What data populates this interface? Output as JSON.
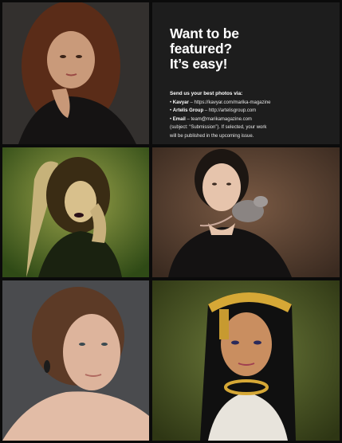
{
  "promo": {
    "headline_line1": "Want to be",
    "headline_line2": "featured?",
    "headline_line3": "It’s easy!",
    "intro": "Send us your best photos via:",
    "items": [
      {
        "bullet": "•",
        "name": "Kavyar",
        "text": " – https://kavyar.com/marika-magazine"
      },
      {
        "bullet": "•",
        "name": "Artelis Group",
        "text": " – http://artelisgroup.com"
      },
      {
        "bullet": "•",
        "name": "Email",
        "text": " – team@marikamagazine.com"
      }
    ],
    "note_line1": "(subject: “Submission”). If selected, your work",
    "note_line2": "will be published in the upcoming issue."
  },
  "photos": [
    {
      "id": "photo-1",
      "subject": "woman with curly auburn hair, hand on chin, black top"
    },
    {
      "id": "photo-2",
      "subject": "woman with dark lipstick, arm raised, green toned"
    },
    {
      "id": "photo-3",
      "subject": "woman with dark hair holding a rat on shoulder"
    },
    {
      "id": "photo-4",
      "subject": "woman with short hair and earrings, bare shoulders"
    },
    {
      "id": "photo-5",
      "subject": "woman in gold Egyptian headdress"
    }
  ],
  "colors": {
    "background": "#0b0b0b",
    "promo_panel": "#1d1d1d",
    "text": "#ffffff"
  }
}
